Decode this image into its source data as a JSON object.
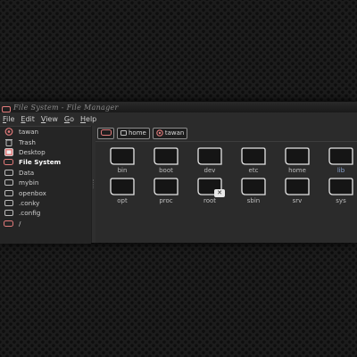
{
  "window": {
    "title": "File System - File Manager"
  },
  "menu": [
    "File",
    "Edit",
    "View",
    "Go",
    "Help"
  ],
  "sidebar": {
    "items": [
      {
        "label": "tawan",
        "icon": "home-icon",
        "active": false
      },
      {
        "label": "Trash",
        "icon": "trash-icon",
        "active": false
      },
      {
        "label": "Desktop",
        "icon": "desktop-icon",
        "active": false
      },
      {
        "label": "File System",
        "icon": "drive-icon",
        "active": true
      },
      {
        "label": "Data",
        "icon": "folder-icon",
        "active": false
      },
      {
        "label": "mybin",
        "icon": "folder-icon",
        "active": false
      },
      {
        "label": "openbox",
        "icon": "folder-icon",
        "active": false
      },
      {
        "label": ".conky",
        "icon": "folder-icon",
        "active": false
      },
      {
        "label": ".config",
        "icon": "folder-icon",
        "active": false
      },
      {
        "label": "/",
        "icon": "drive-icon",
        "active": false
      }
    ]
  },
  "pathbar": {
    "buttons": [
      {
        "label": "home",
        "icon": "folder-icon"
      },
      {
        "label": "tawan",
        "icon": "home-icon"
      }
    ]
  },
  "folders": [
    {
      "name": "bin",
      "emblem": false
    },
    {
      "name": "boot",
      "emblem": false
    },
    {
      "name": "dev",
      "emblem": false
    },
    {
      "name": "etc",
      "emblem": false
    },
    {
      "name": "home",
      "emblem": false
    },
    {
      "name": "lib",
      "emblem": false,
      "highlight": true
    },
    {
      "name": "opt",
      "emblem": false
    },
    {
      "name": "proc",
      "emblem": false
    },
    {
      "name": "root",
      "emblem": true
    },
    {
      "name": "sbin",
      "emblem": false
    },
    {
      "name": "srv",
      "emblem": false
    },
    {
      "name": "sys",
      "emblem": false
    }
  ],
  "colors": {
    "accent": "#e07a7a",
    "link_label": "#8aa4cf"
  }
}
